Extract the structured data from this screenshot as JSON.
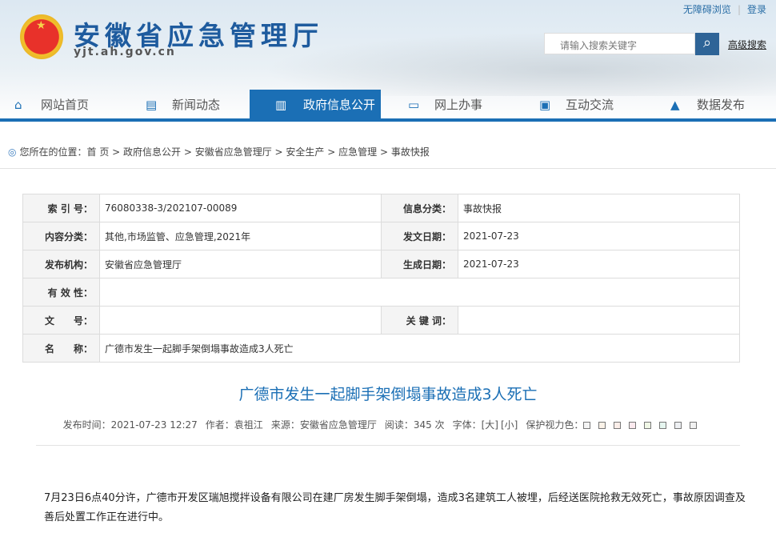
{
  "header": {
    "title": "安徽省应急管理厅",
    "domain": "yjt.ah.gov.cn",
    "accessibility": "无障碍浏览",
    "login": "登录",
    "search_placeholder": "请输入搜索关键字",
    "advanced_search": "高级搜索"
  },
  "nav": [
    {
      "label": "网站首页",
      "icon": "home-icon"
    },
    {
      "label": "新闻动态",
      "icon": "news-icon"
    },
    {
      "label": "政府信息公开",
      "icon": "document-icon"
    },
    {
      "label": "网上办事",
      "icon": "monitor-icon"
    },
    {
      "label": "互动交流",
      "icon": "chat-icon"
    },
    {
      "label": "数据发布",
      "icon": "chart-icon"
    }
  ],
  "breadcrumb": {
    "prefix": "您所在的位置：",
    "items": [
      "首 页",
      "政府信息公开",
      "安徽省应急管理厅",
      "安全生产",
      "应急管理",
      "事故快报"
    ]
  },
  "info": {
    "index_k": "索 引 号：",
    "index_v": "76080338-3/202107-00089",
    "cat_k": "信息分类：",
    "cat_v": "事故快报",
    "content_k": "内容分类：",
    "content_v": "其他,市场监管、应急管理,2021年",
    "date_k": "发文日期：",
    "date_v": "2021-07-23",
    "org_k": "发布机构：",
    "org_v": "安徽省应急管理厅",
    "gen_k": "生成日期：",
    "gen_v": "2021-07-23",
    "valid_k": "有 效 性：",
    "valid_v": "",
    "docno_k": "文　　号：",
    "docno_v": "",
    "kw_k": "关 键 词：",
    "kw_v": "",
    "name_k": "名　　称：",
    "name_v": "广德市发生一起脚手架倒塌事故造成3人死亡"
  },
  "article": {
    "title": "广德市发生一起脚手架倒塌事故造成3人死亡",
    "time": "发布时间：2021-07-23 12:27",
    "author": "作者：袁祖江",
    "source": "来源：安徽省应急管理厅",
    "reads": "阅读：345 次",
    "font_label": "字体：",
    "font_big": "[大]",
    "font_small": "[小]",
    "eye_label": "保护视力色：",
    "swatches": [
      "#f4f4f4",
      "#faf2e8",
      "#fbeee9",
      "#fbe9ee",
      "#f0f7e6",
      "#e6f6f0",
      "#eef0f3",
      "#f1f1f1"
    ],
    "body": "7月23日6点40分许，广德市开发区瑞旭搅拌设备有限公司在建厂房发生脚手架倒塌，造成3名建筑工人被埋，后经送医院抢救无效死亡，事故原因调查及善后处置工作正在进行中。"
  }
}
